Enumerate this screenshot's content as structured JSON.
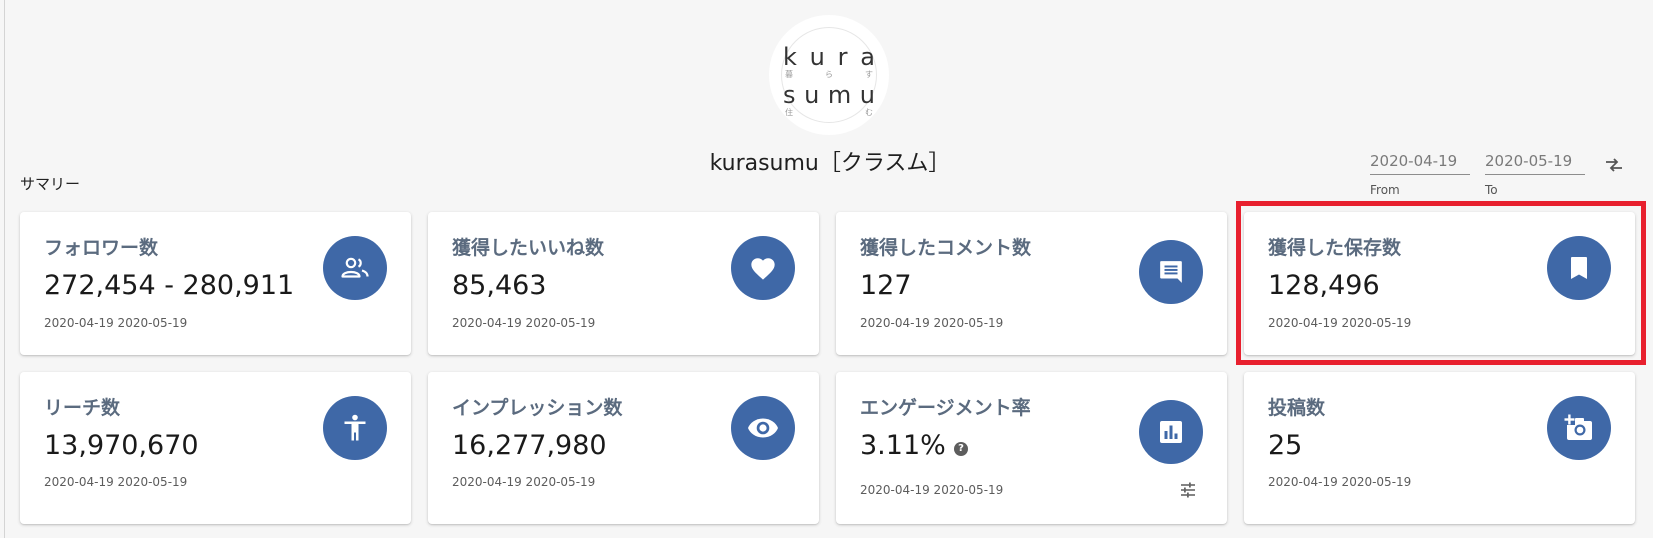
{
  "header": {
    "logo": {
      "row1": [
        "k",
        "u",
        "r",
        "a"
      ],
      "row1_sub": [
        "暮",
        "ら",
        "す"
      ],
      "row2": [
        "s",
        "u",
        "m",
        "u"
      ],
      "row2_sub": [
        "住",
        "む"
      ]
    },
    "account_name": "kurasumu［クラスム］",
    "section_label": "サマリー"
  },
  "date_range": {
    "from_value": "2020-04-19",
    "from_label": "From",
    "to_value": "2020-05-19",
    "to_label": "To",
    "compare_icon": "compare-arrows-icon"
  },
  "cards": [
    {
      "title": "フォロワー数",
      "value": "272,454 - 280,911",
      "range": "2020-04-19 2020-05-19",
      "icon": "people-icon"
    },
    {
      "title": "獲得したいいね数",
      "value": "85,463",
      "range": "2020-04-19 2020-05-19",
      "icon": "heart-icon"
    },
    {
      "title": "獲得したコメント数",
      "value": "127",
      "range": "2020-04-19 2020-05-19",
      "icon": "comment-icon"
    },
    {
      "title": "獲得した保存数",
      "value": "128,496",
      "range": "2020-04-19 2020-05-19",
      "icon": "bookmark-icon",
      "highlighted": true
    },
    {
      "title": "リーチ数",
      "value": "13,970,670",
      "range": "2020-04-19 2020-05-19",
      "icon": "accessibility-icon"
    },
    {
      "title": "インプレッション数",
      "value": "16,277,980",
      "range": "2020-04-19 2020-05-19",
      "icon": "eye-icon"
    },
    {
      "title": "エンゲージメント率",
      "value": "3.11%",
      "range": "2020-04-19 2020-05-19",
      "icon": "bar-chart-icon",
      "help_icon": "help-icon",
      "help_glyph": "?",
      "settings_icon": "tune-icon"
    },
    {
      "title": "投稿数",
      "value": "25",
      "range": "2020-04-19 2020-05-19",
      "icon": "add-photo-icon"
    }
  ],
  "colors": {
    "accent": "#3f68a7",
    "highlight": "#e8202e",
    "background": "#f6f6f6",
    "card_title": "#5b6b7f"
  }
}
